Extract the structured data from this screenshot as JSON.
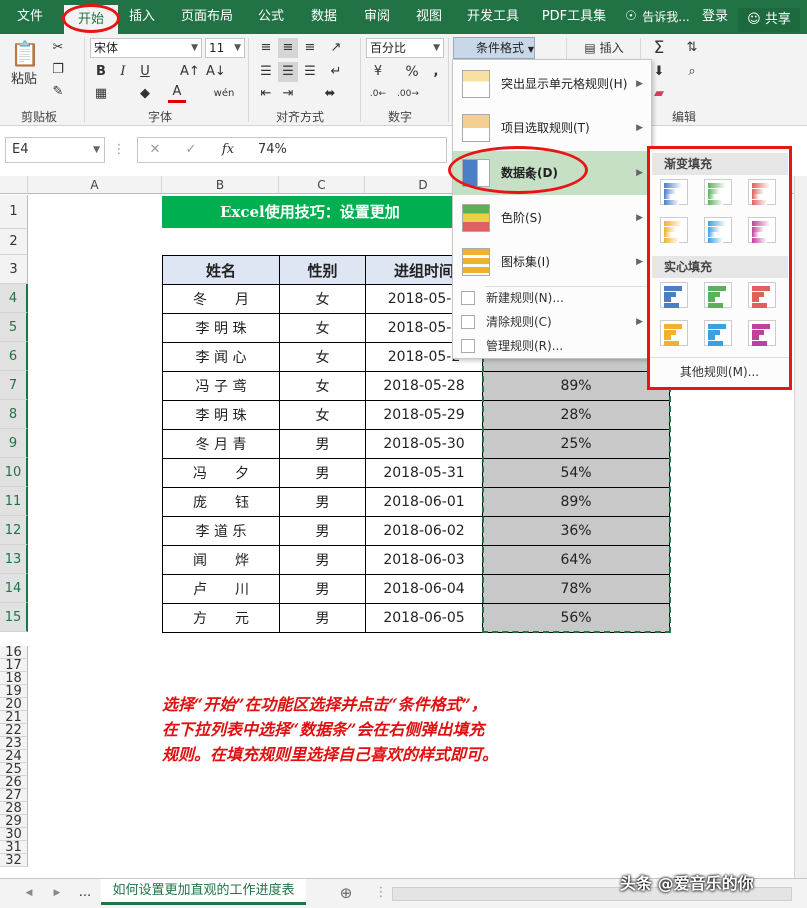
{
  "ribbon_tabs": [
    "文件",
    "开始",
    "插入",
    "页面布局",
    "公式",
    "数据",
    "审阅",
    "视图",
    "开发工具",
    "PDF工具集"
  ],
  "tell_me": "告诉我...",
  "login": "登录",
  "share": "共享",
  "clipboard": {
    "paste": "粘贴",
    "label": "剪贴板"
  },
  "font": {
    "name": "宋体",
    "size": "11",
    "label": "字体",
    "bold": "B",
    "italic": "I",
    "underline": "U",
    "color_letter": "A",
    "phonetic": "wén"
  },
  "alignment": {
    "label": "对齐方式"
  },
  "number": {
    "format": "百分比",
    "label": "数字"
  },
  "styles": {
    "conditional_format": "条件格式"
  },
  "cells": {
    "insert": "插入"
  },
  "editing": {
    "label": "编辑"
  },
  "formula_bar": {
    "name_box": "E4",
    "value": "74%",
    "fx": "fx"
  },
  "columns": [
    "A",
    "B",
    "C",
    "D"
  ],
  "rows": [
    "1",
    "2",
    "3",
    "4",
    "5",
    "6",
    "7",
    "8",
    "9",
    "10",
    "11",
    "12",
    "13",
    "14",
    "15",
    "16",
    "17",
    "18",
    "19",
    "20",
    "21",
    "22",
    "23",
    "24",
    "25",
    "26",
    "27",
    "28",
    "29",
    "30",
    "31",
    "32"
  ],
  "sheet_title": "Excel使用技巧：设置更加",
  "table": {
    "headers": [
      "姓名",
      "性别",
      "进组时间"
    ],
    "rows": [
      {
        "name": "冬　　月",
        "sex": "女",
        "date": "2018-05-2",
        "pct": ""
      },
      {
        "name": "李 明 珠",
        "sex": "女",
        "date": "2018-05-2",
        "pct": ""
      },
      {
        "name": "李 闻 心",
        "sex": "女",
        "date": "2018-05-2",
        "pct": ""
      },
      {
        "name": "冯 子 鸢",
        "sex": "女",
        "date": "2018-05-28",
        "pct": "89%"
      },
      {
        "name": "李 明 珠",
        "sex": "女",
        "date": "2018-05-29",
        "pct": "28%"
      },
      {
        "name": "冬 月 青",
        "sex": "男",
        "date": "2018-05-30",
        "pct": "25%"
      },
      {
        "name": "冯　　夕",
        "sex": "男",
        "date": "2018-05-31",
        "pct": "54%"
      },
      {
        "name": "庞　　钰",
        "sex": "男",
        "date": "2018-06-01",
        "pct": "89%"
      },
      {
        "name": "李 道 乐",
        "sex": "男",
        "date": "2018-06-02",
        "pct": "36%"
      },
      {
        "name": "闻　　烨",
        "sex": "男",
        "date": "2018-06-03",
        "pct": "64%"
      },
      {
        "name": "卢　　川",
        "sex": "男",
        "date": "2018-06-04",
        "pct": "78%"
      },
      {
        "name": "方　　元",
        "sex": "男",
        "date": "2018-06-05",
        "pct": "56%"
      }
    ]
  },
  "note_lines": [
    "选择“开始”在功能区选择并点击“条件格式”，",
    "在下拉列表中选择“数据条”会在右侧弹出填充",
    "规则。在填充规则里选择自己喜欢的样式即可。"
  ],
  "cf_menu": {
    "highlight_rules": "突出显示单元格规则(H)",
    "top_bottom": "项目选取规则(T)",
    "data_bars": "数据条(D)",
    "color_scales": "色阶(S)",
    "icon_sets": "图标集(I)",
    "new_rule": "新建规则(N)...",
    "clear_rules": "清除规则(C)",
    "manage_rules": "管理规则(R)..."
  },
  "data_bar_submenu": {
    "gradient_fill": "渐变填充",
    "solid_fill": "实心填充",
    "more_rules": "其他规则(M)...",
    "colors": [
      "#4a7fc6",
      "#5bb15b",
      "#e06060",
      "#f0b030",
      "#3aa0e0",
      "#c040a0"
    ]
  },
  "sheet_tab": "如何设置更加直观的工作进度表",
  "more_tabs": "...",
  "watermark": "头条 @爱音乐的你",
  "accent": "#217346"
}
